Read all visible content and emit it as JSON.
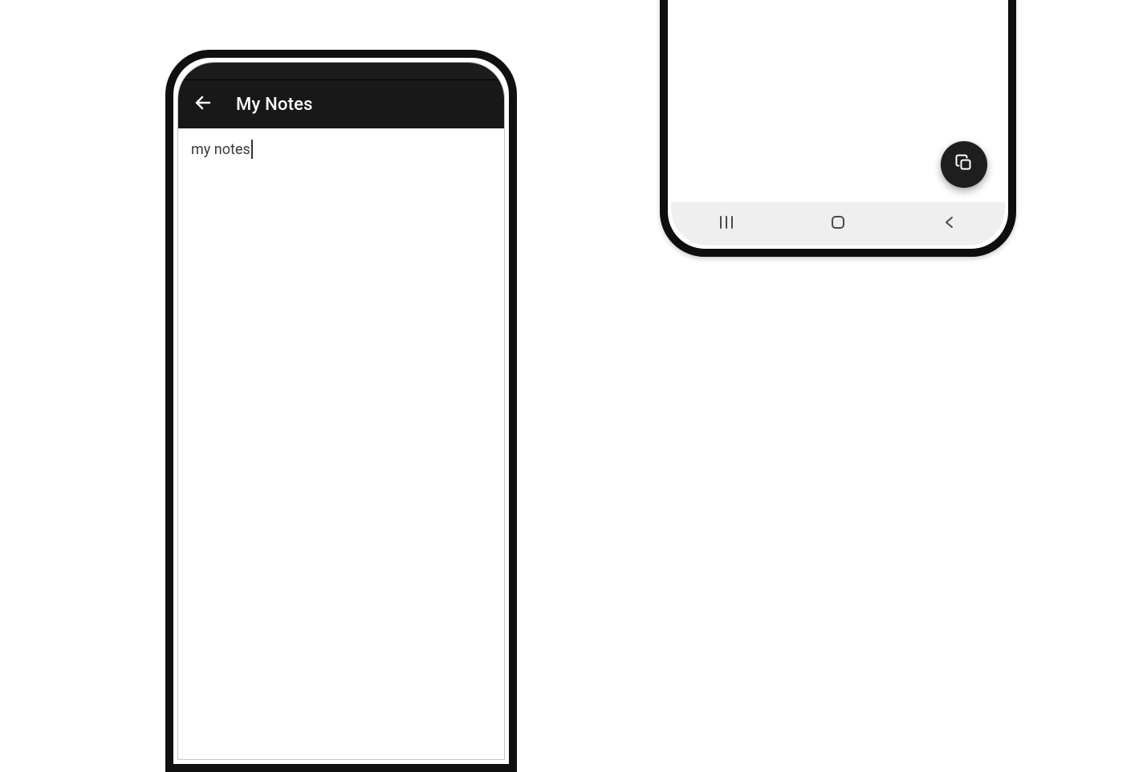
{
  "left_phone": {
    "app_bar": {
      "title": "My Notes",
      "back_icon": "arrow-left"
    },
    "note": {
      "text": "my notes"
    }
  },
  "right_phone": {
    "fab": {
      "icon": "copy"
    },
    "navbar": {
      "buttons": [
        "recents",
        "home",
        "back"
      ]
    }
  }
}
